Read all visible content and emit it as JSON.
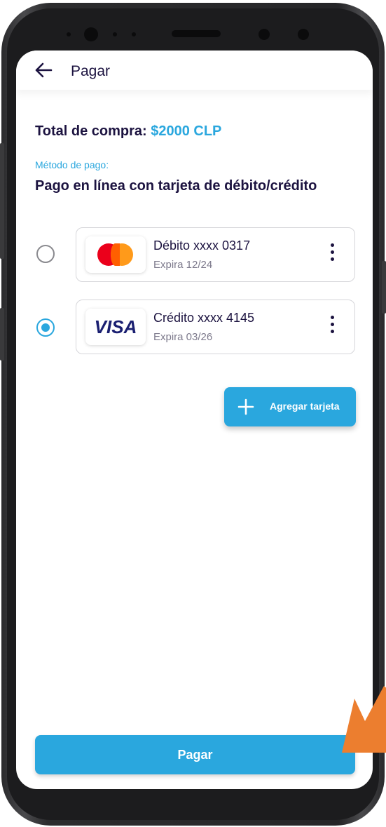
{
  "header": {
    "title": "Pagar"
  },
  "summary": {
    "total_label": "Total de compra:",
    "total_amount": "$2000 CLP",
    "method_label": "Método de pago:",
    "method_value": "Pago en línea con tarjeta de débito/crédito"
  },
  "cards": [
    {
      "brand": "mastercard",
      "name": "Débito xxxx 0317",
      "expiry": "Expira 12/24",
      "selected": false
    },
    {
      "brand": "visa",
      "brand_text": "VISA",
      "name": "Crédito xxxx 4145",
      "expiry": "Expira 03/26",
      "selected": true
    }
  ],
  "actions": {
    "add_card_label": "Agregar tarjeta",
    "pay_label": "Pagar"
  },
  "colors": {
    "accent": "#2aa7de",
    "text_dark": "#1c1340",
    "text_muted": "#7d7a8c",
    "pointer_arrow": "#ec7e2f"
  },
  "icons": {
    "back": "arrow-left-icon",
    "more": "kebab-menu-icon",
    "add": "plus-icon",
    "pointer": "orange-arrow-icon"
  }
}
